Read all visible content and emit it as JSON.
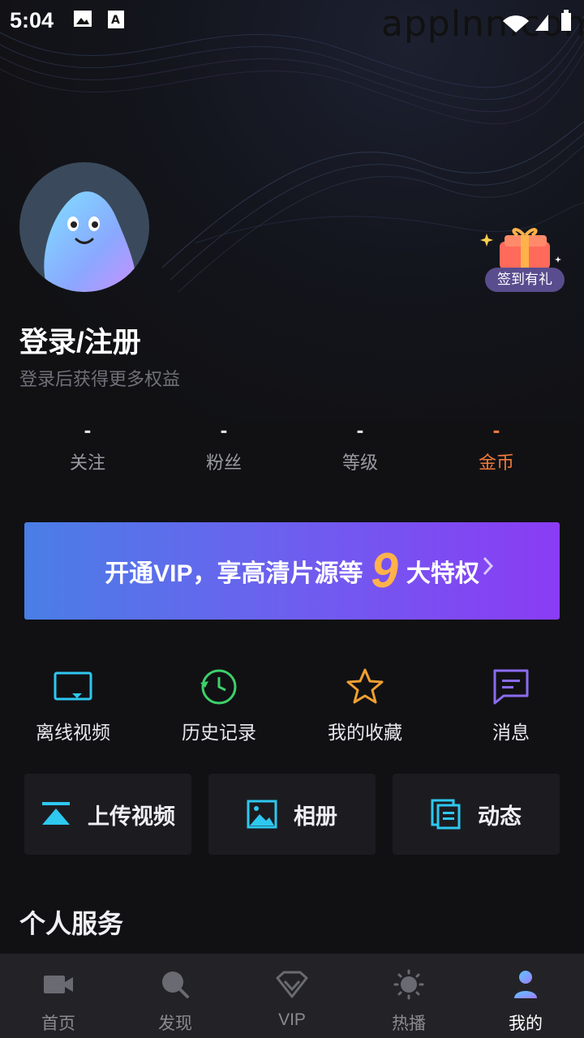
{
  "status_bar": {
    "time": "5:04",
    "watermark": "applnn.com"
  },
  "profile": {
    "login_title": "登录/注册",
    "login_subtitle": "登录后获得更多权益",
    "checkin_badge": "签到有礼"
  },
  "stats": [
    {
      "value": "-",
      "label": "关注"
    },
    {
      "value": "-",
      "label": "粉丝"
    },
    {
      "value": "-",
      "label": "等级"
    },
    {
      "value": "-",
      "label": "金币"
    }
  ],
  "vip_banner": {
    "text_before": "开通VIP，享高清片源等",
    "number": "9",
    "text_after": "大特权"
  },
  "quick_actions": [
    {
      "label": "离线视频",
      "icon": "offline-video-icon"
    },
    {
      "label": "历史记录",
      "icon": "history-icon"
    },
    {
      "label": "我的收藏",
      "icon": "star-icon"
    },
    {
      "label": "消息",
      "icon": "message-icon"
    }
  ],
  "cards": [
    {
      "label": "上传视频",
      "icon": "upload-icon"
    },
    {
      "label": "相册",
      "icon": "photo-album-icon"
    },
    {
      "label": "动态",
      "icon": "feed-icon"
    }
  ],
  "section_title": "个人服务",
  "tabs": [
    {
      "label": "首页",
      "icon": "video-camera-icon",
      "active": false
    },
    {
      "label": "发现",
      "icon": "search-icon",
      "active": false
    },
    {
      "label": "VIP",
      "icon": "vip-diamond-icon",
      "active": false
    },
    {
      "label": "热播",
      "icon": "sun-icon",
      "active": false
    },
    {
      "label": "我的",
      "icon": "person-icon",
      "active": true
    }
  ],
  "colors": {
    "background": "#111114",
    "gold": "#f07a3c",
    "vip_start": "#4a7ee6",
    "vip_end": "#8a3cf4",
    "accent_cyan": "#2ec8f0"
  }
}
